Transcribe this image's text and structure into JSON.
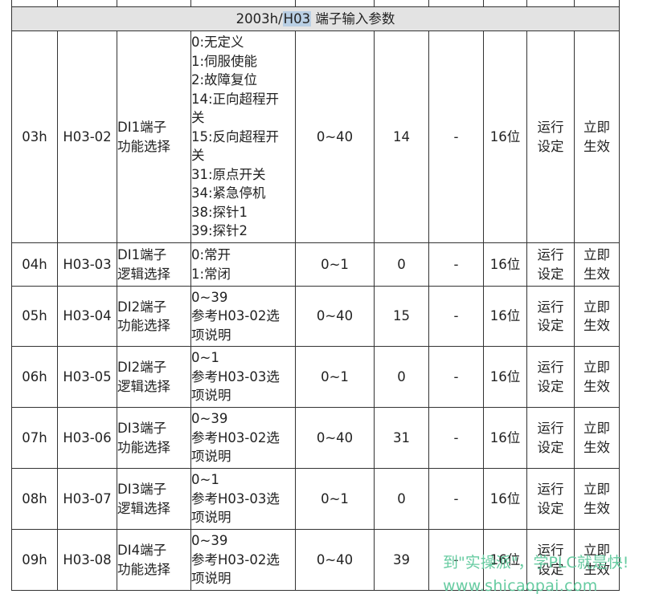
{
  "table": {
    "title_prefix": "2003h/",
    "title_highlight": "H03",
    "title_suffix": " 端子输入参数",
    "rows": [
      {
        "index": "03h",
        "code": "H03-02",
        "name": [
          "DI1端子",
          "功能选择"
        ],
        "desc": [
          "0:无定义",
          "1:伺服使能",
          "2:故障复位",
          "14:正向超程开",
          "关",
          "15:反向超程开",
          "关",
          "31:原点开关",
          "34:紧急停机",
          "38:探针1",
          "39:探针2"
        ],
        "range": "0~40",
        "default": "14",
        "dash": "-",
        "unit": "16位",
        "mode": [
          "运行",
          "设定"
        ],
        "effect": [
          "立即",
          "生效"
        ]
      },
      {
        "index": "04h",
        "code": "H03-03",
        "name": [
          "DI1端子",
          "逻辑选择"
        ],
        "desc": [
          "0:常开",
          "1:常闭"
        ],
        "range": "0~1",
        "default": "0",
        "dash": "-",
        "unit": "16位",
        "mode": [
          "运行",
          "设定"
        ],
        "effect": [
          "立即",
          "生效"
        ]
      },
      {
        "index": "05h",
        "code": "H03-04",
        "name": [
          "DI2端子",
          "功能选择"
        ],
        "desc": [
          "0~39",
          "参考H03-02选",
          "项说明"
        ],
        "range": "0~40",
        "default": "15",
        "dash": "-",
        "unit": "16位",
        "mode": [
          "运行",
          "设定"
        ],
        "effect": [
          "立即",
          "生效"
        ]
      },
      {
        "index": "06h",
        "code": "H03-05",
        "name": [
          "DI2端子",
          "逻辑选择"
        ],
        "desc": [
          "0~1",
          "参考H03-03选",
          "项说明"
        ],
        "range": "0~1",
        "default": "0",
        "dash": "-",
        "unit": "16位",
        "mode": [
          "运行",
          "设定"
        ],
        "effect": [
          "立即",
          "生效"
        ]
      },
      {
        "index": "07h",
        "code": "H03-06",
        "name": [
          "DI3端子",
          "功能选择"
        ],
        "desc": [
          "0~39",
          "参考H03-02选",
          "项说明"
        ],
        "range": "0~40",
        "default": "31",
        "dash": "-",
        "unit": "16位",
        "mode": [
          "运行",
          "设定"
        ],
        "effect": [
          "立即",
          "生效"
        ]
      },
      {
        "index": "08h",
        "code": "H03-07",
        "name": [
          "DI3端子",
          "逻辑选择"
        ],
        "desc": [
          "0~1",
          "参考H03-03选",
          "项说明"
        ],
        "range": "0~1",
        "default": "0",
        "dash": "-",
        "unit": "16位",
        "mode": [
          "运行",
          "设定"
        ],
        "effect": [
          "立即",
          "生效"
        ]
      },
      {
        "index": "09h",
        "code": "H03-08",
        "name": [
          "DI4端子",
          "功能选择"
        ],
        "desc": [
          "0~39",
          "参考H03-02选",
          "项说明"
        ],
        "range": "0~40",
        "default": "39",
        "dash": "-",
        "unit": "16位",
        "mode": [
          "运行",
          "设定"
        ],
        "effect": [
          "立即",
          "生效"
        ]
      }
    ]
  },
  "watermark": {
    "line1": "到\"实操派\"，学PLC就是快!",
    "line2": "www.shicaopai.com"
  }
}
